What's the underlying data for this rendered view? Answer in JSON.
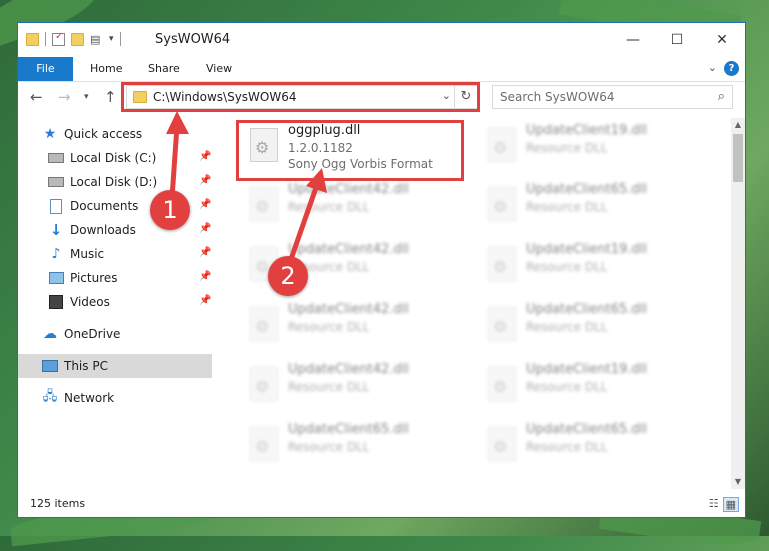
{
  "window": {
    "title": "SysWOW64",
    "controls": {
      "minimize": "—",
      "maximize": "☐",
      "close": "✕"
    }
  },
  "ribbon": {
    "tabs": [
      "File",
      "Home",
      "Share",
      "View"
    ],
    "help": "?",
    "collapse": "⌄"
  },
  "address": {
    "path": "C:\\Windows\\SysWOW64",
    "dropdown": "⌄",
    "refresh": "↻"
  },
  "search": {
    "placeholder": "Search SysWOW64",
    "icon": "magnifier"
  },
  "sidebar": {
    "quick_access": "Quick access",
    "items": [
      {
        "label": "Local Disk (C:)",
        "icon": "drive-icon",
        "pinned": true
      },
      {
        "label": "Local Disk (D:)",
        "icon": "drive-icon",
        "pinned": true
      },
      {
        "label": "Documents",
        "icon": "documents-icon",
        "pinned": true
      },
      {
        "label": "Downloads",
        "icon": "downloads-icon",
        "pinned": true
      },
      {
        "label": "Music",
        "icon": "music-icon",
        "pinned": true
      },
      {
        "label": "Pictures",
        "icon": "pictures-icon",
        "pinned": true
      },
      {
        "label": "Videos",
        "icon": "videos-icon",
        "pinned": true
      }
    ],
    "onedrive": "OneDrive",
    "this_pc": "This PC",
    "network": "Network"
  },
  "files": [
    {
      "name": "oggplug.dll",
      "line1": "1.2.0.1182",
      "line2": "Sony Ogg Vorbis Format",
      "highlighted": true
    },
    {
      "name": "UpdateClient19.dll",
      "line1": "Resource DLL"
    },
    {
      "name": "UpdateClient42.dll",
      "line1": "Resource DLL"
    },
    {
      "name": "UpdateClient65.dll",
      "line1": "Resource DLL"
    },
    {
      "name": "UpdateClient42.dll",
      "line1": "Resource DLL"
    },
    {
      "name": "UpdateClient19.dll",
      "line1": "Resource DLL"
    },
    {
      "name": "UpdateClient42.dll",
      "line1": "Resource DLL"
    },
    {
      "name": "UpdateClient65.dll",
      "line1": "Resource DLL"
    },
    {
      "name": "UpdateClient42.dll",
      "line1": "Resource DLL"
    },
    {
      "name": "UpdateClient19.dll",
      "line1": "Resource DLL"
    },
    {
      "name": "UpdateClient65.dll",
      "line1": "Resource DLL"
    },
    {
      "name": "UpdateClient65.dll",
      "line1": "Resource DLL"
    }
  ],
  "status": {
    "items": "125 items"
  },
  "annotations": {
    "step1": "1",
    "step2": "2",
    "color": "#e23f3f"
  }
}
